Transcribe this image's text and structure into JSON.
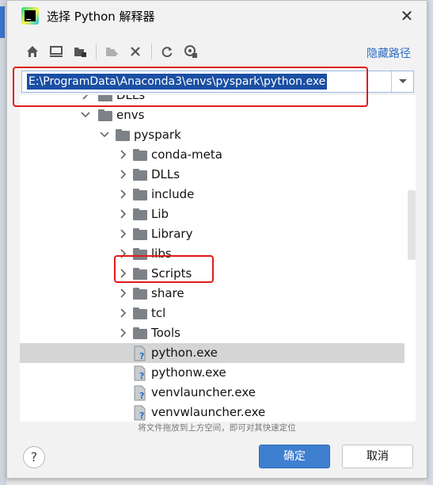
{
  "window": {
    "title": "选择 Python 解释器",
    "close_glyph": "✕"
  },
  "toolbar": {
    "icons": [
      "home-icon",
      "desktop-icon",
      "project-folder-icon",
      "new-folder-icon",
      "delete-icon",
      "refresh-icon",
      "show-hidden-icon"
    ],
    "hide_path_label": "隐藏路径"
  },
  "path": {
    "value": "E:\\ProgramData\\Anaconda3\\envs\\pyspark\\python.exe"
  },
  "tree": {
    "items": [
      {
        "label": "DLLs",
        "type": "folder",
        "depth": 1,
        "expanded": false
      },
      {
        "label": "envs",
        "type": "folder",
        "depth": 1,
        "expanded": true
      },
      {
        "label": "pyspark",
        "type": "folder",
        "depth": 2,
        "expanded": true
      },
      {
        "label": "conda-meta",
        "type": "folder",
        "depth": 3,
        "expanded": false
      },
      {
        "label": "DLLs",
        "type": "folder",
        "depth": 3,
        "expanded": false
      },
      {
        "label": "include",
        "type": "folder",
        "depth": 3,
        "expanded": false
      },
      {
        "label": "Lib",
        "type": "folder",
        "depth": 3,
        "expanded": false
      },
      {
        "label": "Library",
        "type": "folder",
        "depth": 3,
        "expanded": false
      },
      {
        "label": "libs",
        "type": "folder",
        "depth": 3,
        "expanded": false
      },
      {
        "label": "Scripts",
        "type": "folder",
        "depth": 3,
        "expanded": false
      },
      {
        "label": "share",
        "type": "folder",
        "depth": 3,
        "expanded": false
      },
      {
        "label": "tcl",
        "type": "folder",
        "depth": 3,
        "expanded": false
      },
      {
        "label": "Tools",
        "type": "folder",
        "depth": 3,
        "expanded": false
      },
      {
        "label": "python.exe",
        "type": "file",
        "depth": 3,
        "selected": true
      },
      {
        "label": "pythonw.exe",
        "type": "file",
        "depth": 3
      },
      {
        "label": "venvlauncher.exe",
        "type": "file",
        "depth": 3
      },
      {
        "label": "venvwlauncher.exe",
        "type": "file",
        "depth": 3
      }
    ]
  },
  "hint": "将文件拖放到上方空间，即可对其快速定位",
  "buttons": {
    "help": "?",
    "ok": "确定",
    "cancel": "取消"
  },
  "colors": {
    "accent": "#3f7fd0",
    "annotation": "#e01b1b",
    "selection": "#1a4fa3"
  }
}
